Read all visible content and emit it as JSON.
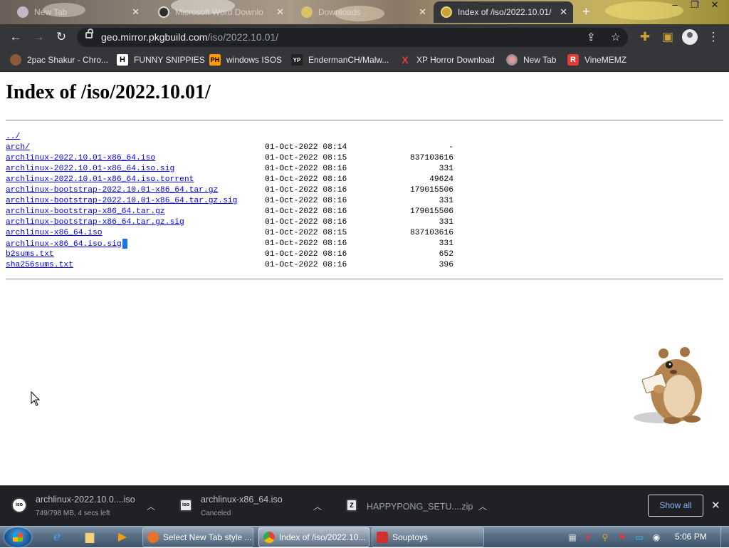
{
  "browser": {
    "tabs": [
      {
        "title": "New Tab",
        "active": false
      },
      {
        "title": "Microsoft Word Downlo",
        "active": false
      },
      {
        "title": "Downloads",
        "active": false
      },
      {
        "title": "Index of /iso/2022.10.01/",
        "active": true
      }
    ],
    "new_tab_symbol": "+",
    "url": {
      "host": "geo.mirror.pkgbuild.com",
      "path": "/iso/2022.10.01/"
    },
    "bookmarks": [
      {
        "label": "2pac Shakur - Chro...",
        "icon": "2pac-favicon"
      },
      {
        "label": "FUNNY SNIPPIES",
        "icon": "H"
      },
      {
        "label": "windows ISOS",
        "icon": "PH"
      },
      {
        "label": "EndermanCH/Malw...",
        "icon": "YP"
      },
      {
        "label": "XP Horror Download",
        "icon": "X"
      },
      {
        "label": "New Tab",
        "icon": "globe-favicon"
      },
      {
        "label": "VineMEMZ",
        "icon": "R"
      }
    ]
  },
  "page": {
    "heading": "Index of /iso/2022.10.01/",
    "entries": [
      {
        "name": "../",
        "date": "",
        "size": ""
      },
      {
        "name": "arch/",
        "date": "01-Oct-2022 08:14",
        "size": "-"
      },
      {
        "name": "archlinux-2022.10.01-x86_64.iso",
        "date": "01-Oct-2022 08:15",
        "size": "837103616"
      },
      {
        "name": "archlinux-2022.10.01-x86_64.iso.sig",
        "date": "01-Oct-2022 08:16",
        "size": "331"
      },
      {
        "name": "archlinux-2022.10.01-x86_64.iso.torrent",
        "date": "01-Oct-2022 08:16",
        "size": "49624"
      },
      {
        "name": "archlinux-bootstrap-2022.10.01-x86_64.tar.gz",
        "date": "01-Oct-2022 08:16",
        "size": "179015506"
      },
      {
        "name": "archlinux-bootstrap-2022.10.01-x86_64.tar.gz.sig",
        "date": "01-Oct-2022 08:16",
        "size": "331"
      },
      {
        "name": "archlinux-bootstrap-x86_64.tar.gz",
        "date": "01-Oct-2022 08:16",
        "size": "179015506"
      },
      {
        "name": "archlinux-bootstrap-x86_64.tar.gz.sig",
        "date": "01-Oct-2022 08:16",
        "size": "331"
      },
      {
        "name": "archlinux-x86_64.iso",
        "date": "01-Oct-2022 08:15",
        "size": "837103616"
      },
      {
        "name": "archlinux-x86_64.iso.sig",
        "date": "01-Oct-2022 08:16",
        "size": "331"
      },
      {
        "name": "b2sums.txt",
        "date": "01-Oct-2022 08:16",
        "size": "652"
      },
      {
        "name": "sha256sums.txt",
        "date": "01-Oct-2022 08:16",
        "size": "396"
      }
    ]
  },
  "downloads": {
    "items": [
      {
        "name": "archlinux-2022.10.0....iso",
        "status": "749/798 MB, 4 secs left",
        "icon": "iso",
        "progress": 0.94
      },
      {
        "name": "archlinux-x86_64.iso",
        "status": "Canceled",
        "icon": "iso"
      },
      {
        "name": "HAPPYPONG_SETU....zip",
        "status": "",
        "icon": "Z"
      }
    ],
    "show_all": "Show all"
  },
  "taskbar": {
    "tasks": [
      {
        "label": "Select New Tab style ...",
        "active": false
      },
      {
        "label": "Index of /iso/2022.10...",
        "active": true
      },
      {
        "label": "Souptoys",
        "active": false
      }
    ],
    "clock": "5:06 PM"
  },
  "colors": {
    "link": "#0000ee",
    "chrome_dark": "#35363a",
    "download_bar": "#202124",
    "accent_blue": "#8ab4f8"
  }
}
